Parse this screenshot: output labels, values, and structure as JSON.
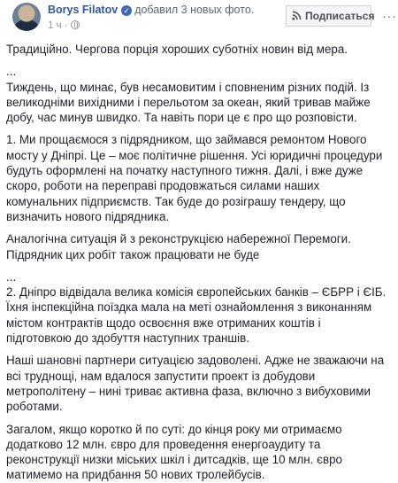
{
  "header": {
    "author": "Borys Filatov",
    "action": "добавил 3 новых фото.",
    "time": "1 ч",
    "follow_label": "Подписаться",
    "more_label": "···"
  },
  "post": {
    "paragraphs": [
      "Традиційно. Чергова порція хороших суботніх новин від мера.",
      "...",
      "Тиждень, що минає, був несамовитим і сповненим різних подій. Із великодніми вихідними і перельотом за океан, який тривав майже добу, час минув швидко. Та навіть пори це є про що розповісти.",
      "1. Ми прощаємося з підрядником, що займався ремонтом Нового мосту у Дніпрі. Це – моє політичне рішення. Усі юридичні процедури будуть оформлені на початку наступного тижня. Далі, і вже дуже скоро, роботи на переправі продовжаться силами наших комунальних підприємств. Так буде до розіграшу тендеру, що визначить нового підрядника.",
      "Аналогічна ситуація й з реконструкцією набережної Перемоги. Підрядник цих робіт також працювати не буде",
      "...",
      "2. Дніпро відвідала велика комісія європейських банків – ЄБРР і ЄІБ. Їхня інспекційна поїздка мала на меті ознайомлення з виконанням містом контрактів щодо освоєння вже отриманих коштів і підготовкою до здобуття наступних траншів.",
      "Наші шановні партнери ситуацією задоволені. Адже не зважаючи на всі труднощі, нам вдалося запустити проект із добудови метрополітену – нині триває активна фаза, включно з вибуховими роботами.",
      "Загалом, якщо коротко й по суті: до кінця року ми отримаємо додатково 12 млн. євро для проведення енергоаудиту та реконструкції низки міських шкіл і дитсадків, ще 10 млн. євро матимемо на придбання 50 нових тролейбусів."
    ]
  },
  "colors": {
    "link": "#365899",
    "verified": "#4267b2",
    "meta": "#90949c"
  },
  "icons": {
    "verified": "check-badge-icon",
    "privacy": "globe-icon",
    "follow": "rss-icon",
    "more": "ellipsis-icon"
  }
}
